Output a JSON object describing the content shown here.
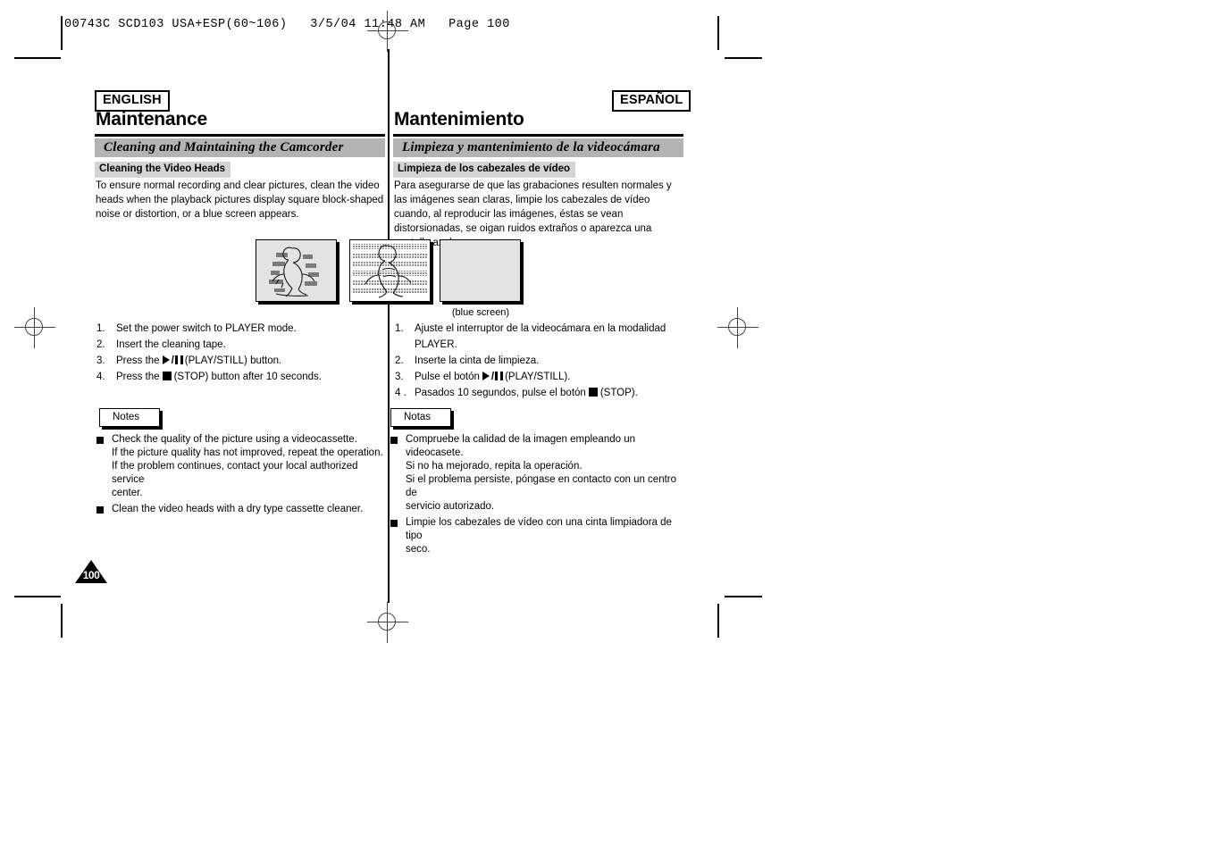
{
  "file_header": "00743C SCD103 USA+ESP(60~106)   3/5/04 11:48 AM   Page 100",
  "page_number": "100",
  "english": {
    "lang_tag": "ENGLISH",
    "chapter_title": "Maintenance",
    "section_bar": "Cleaning and Maintaining the Camcorder",
    "subhead": "Cleaning the Video Heads",
    "body": "To ensure normal recording and clear pictures, clean the video heads when the playback pictures display square block-shaped noise or distortion, or a blue screen appears.",
    "steps": [
      {
        "num": "1.",
        "text": "Set the power switch to PLAYER mode."
      },
      {
        "num": "2.",
        "text": "Insert the cleaning tape."
      },
      {
        "num": "3.",
        "pre": "Press the",
        "glyph": "play-pause",
        "post": "(PLAY/STILL) button."
      },
      {
        "num": "4.",
        "pre": "Press the",
        "glyph": "stop",
        "post": "(STOP) button after 10 seconds."
      }
    ],
    "notes_label": "Notes",
    "notes": [
      [
        "Check the quality of the picture using a videocassette.",
        "If the picture quality has not improved, repeat the operation.",
        "If the problem continues, contact your local authorized service",
        "center."
      ],
      [
        "Clean the video heads with a dry type cassette cleaner."
      ]
    ]
  },
  "spanish": {
    "lang_tag": "ESPAÑOL",
    "chapter_title": "Mantenimiento",
    "section_bar": "Limpieza y mantenimiento de la videocámara",
    "subhead": "Limpieza de los cabezales de vídeo",
    "body": "Para asegurarse de que las grabaciones resulten normales y las imágenes sean claras, limpie los cabezales de vídeo cuando, al reproducir las imágenes, éstas se vean distorsionadas, se oigan ruidos extraños o aparezca una pantalla azul.",
    "steps": [
      {
        "num": "1.",
        "text": "Ajuste el interruptor de la videocámara en la modalidad PLAYER."
      },
      {
        "num": "2.",
        "text": "Inserte la cinta de limpieza."
      },
      {
        "num": "3.",
        "pre": "Pulse el botón",
        "glyph": "play-pause",
        "post": "(PLAY/STILL)."
      },
      {
        "num": "4 .",
        "pre": "Pasados 10 segundos, pulse el botón",
        "glyph": "stop",
        "post": "(STOP)."
      }
    ],
    "notes_label": "Notas",
    "notes": [
      [
        "Compruebe la calidad de la imagen empleando un videocasete.",
        "Si no ha mejorado, repita la operación.",
        "Si el problema persiste, póngase en contacto con un centro de",
        "servicio autorizado."
      ],
      [
        "Limpie los cabezales de vídeo con una cinta limpiadora de tipo",
        "seco."
      ]
    ]
  },
  "figures": {
    "fig1_alt": "distorted-block-noise-picture",
    "fig2_alt": "horizontal-band-noise-picture",
    "fig3_alt": "blank-blue-screen",
    "caption": "(blue screen)"
  }
}
